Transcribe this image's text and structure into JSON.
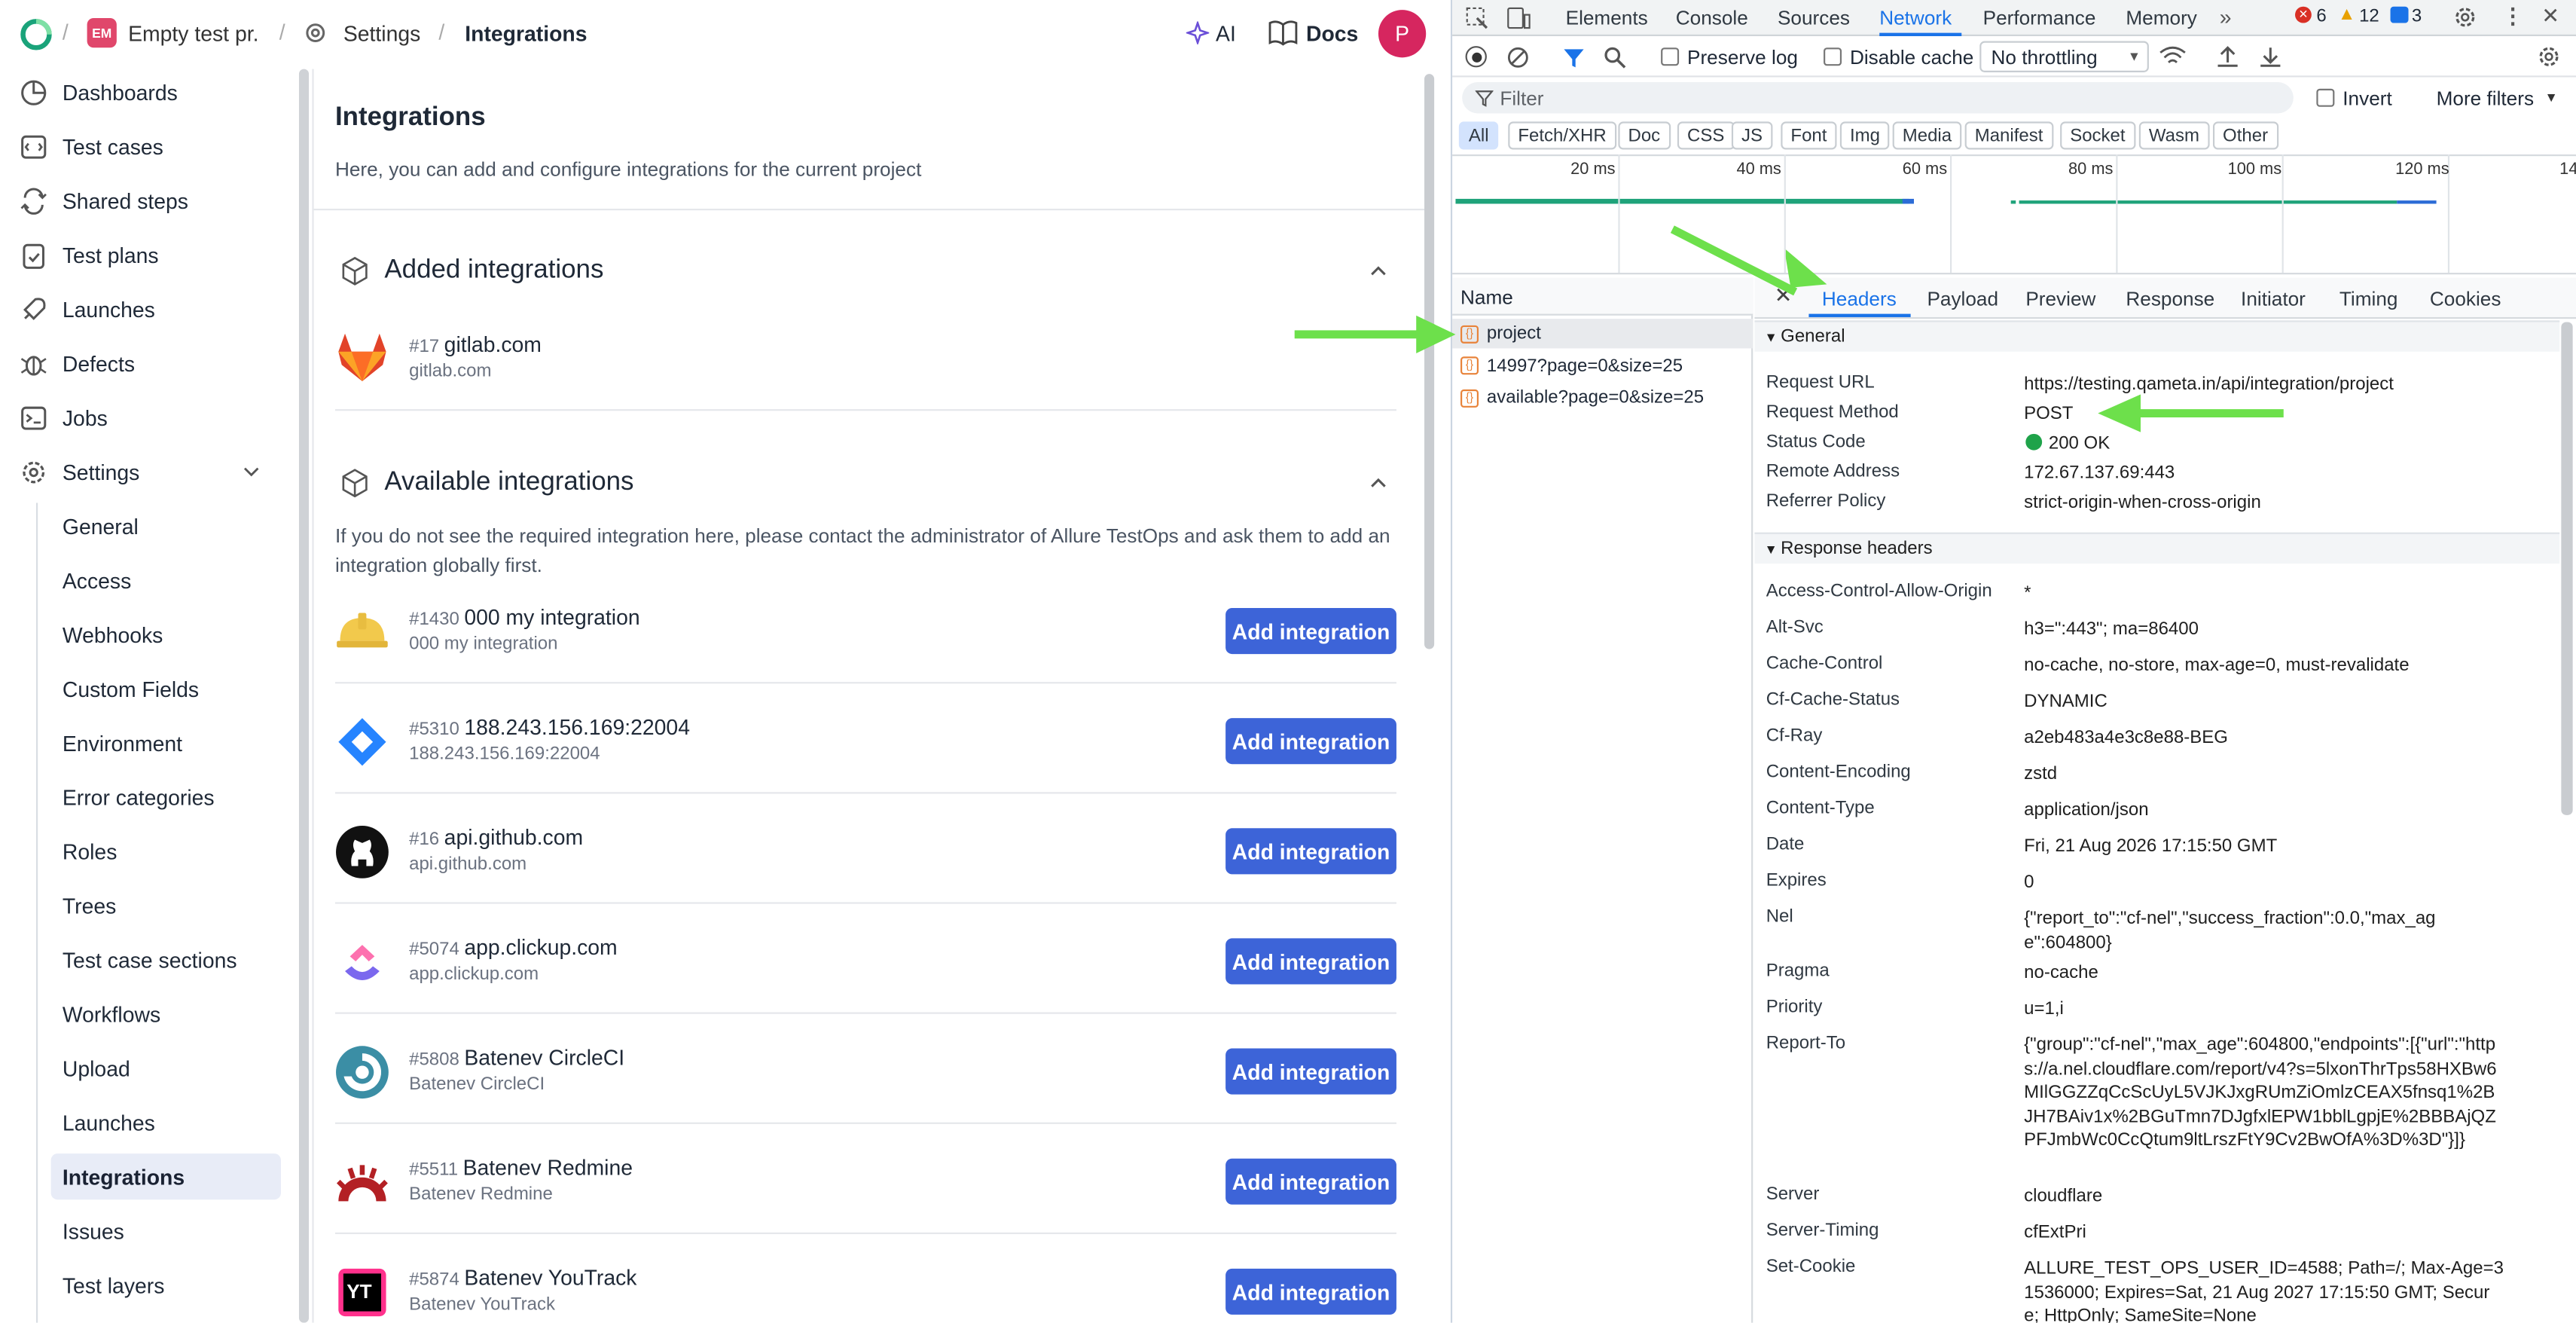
{
  "topbar": {
    "project_badge": "EM",
    "project_name": "Empty test pr.",
    "settings_label": "Settings",
    "current": "Integrations",
    "ai_label": "AI",
    "docs_label": "Docs",
    "avatar_letter": "P"
  },
  "sidebar": {
    "items": [
      {
        "label": "Dashboards",
        "icon": "dashboard-icon"
      },
      {
        "label": "Test cases",
        "icon": "test-cases-icon"
      },
      {
        "label": "Shared steps",
        "icon": "shared-steps-icon"
      },
      {
        "label": "Test plans",
        "icon": "test-plans-icon"
      },
      {
        "label": "Launches",
        "icon": "rocket-icon"
      },
      {
        "label": "Defects",
        "icon": "bug-icon"
      },
      {
        "label": "Jobs",
        "icon": "terminal-icon"
      },
      {
        "label": "Settings",
        "icon": "gear-icon"
      }
    ],
    "settings_sub": [
      "General",
      "Access",
      "Webhooks",
      "Custom Fields",
      "Environment",
      "Error categories",
      "Roles",
      "Trees",
      "Test case sections",
      "Workflows",
      "Upload",
      "Launches",
      "Integrations",
      "Issues",
      "Test layers"
    ]
  },
  "main": {
    "title": "Integrations",
    "subtitle": "Here, you can add and configure integrations for the current project",
    "added_title": "Added integrations",
    "added": {
      "id": "#17",
      "name": "gitlab.com",
      "sub": "gitlab.com"
    },
    "available_title": "Available integrations",
    "available_note": "If you do not see the required integration here, please contact the administrator of Allure TestOps and ask them to add an integration globally first.",
    "add_button": "Add integration",
    "available": [
      {
        "id": "#1430",
        "name": "000 my integration",
        "sub": "000 my integration",
        "icon": "hardhat-icon"
      },
      {
        "id": "#5310",
        "name": "188.243.156.169:22004",
        "sub": "188.243.156.169:22004",
        "icon": "jira-icon"
      },
      {
        "id": "#16",
        "name": "api.github.com",
        "sub": "api.github.com",
        "icon": "github-icon"
      },
      {
        "id": "#5074",
        "name": "app.clickup.com",
        "sub": "app.clickup.com",
        "icon": "clickup-icon"
      },
      {
        "id": "#5808",
        "name": "Batenev CircleCI",
        "sub": "Batenev CircleCI",
        "icon": "circleci-icon"
      },
      {
        "id": "#5511",
        "name": "Batenev Redmine",
        "sub": "Batenev Redmine",
        "icon": "redmine-icon"
      },
      {
        "id": "#5874",
        "name": "Batenev YouTrack",
        "sub": "Batenev YouTrack",
        "icon": "youtrack-icon"
      }
    ]
  },
  "devtools": {
    "tabs": [
      "Elements",
      "Console",
      "Sources",
      "Network",
      "Performance",
      "Memory"
    ],
    "active_tab": "Network",
    "errors": "6",
    "warnings": "12",
    "messages": "3",
    "preserve_log": "Preserve log",
    "disable_cache": "Disable cache",
    "throttling": "No throttling",
    "filter_placeholder": "Filter",
    "invert": "Invert",
    "more_filters": "More filters",
    "type_filters": [
      "All",
      "Fetch/XHR",
      "Doc",
      "CSS",
      "JS",
      "Font",
      "Img",
      "Media",
      "Manifest",
      "Socket",
      "Wasm",
      "Other"
    ],
    "timeline_ticks": [
      "20 ms",
      "40 ms",
      "60 ms",
      "80 ms",
      "100 ms",
      "120 ms",
      "14"
    ],
    "name_header": "Name",
    "requests": [
      "project",
      "14997?page=0&size=25",
      "available?page=0&size=25"
    ],
    "detail_tabs": [
      "Headers",
      "Payload",
      "Preview",
      "Response",
      "Initiator",
      "Timing",
      "Cookies"
    ],
    "general_title": "General",
    "general": [
      {
        "k": "Request URL",
        "v": "https://testing.qameta.in/api/integration/project"
      },
      {
        "k": "Request Method",
        "v": "POST"
      },
      {
        "k": "Status Code",
        "v": "200 OK"
      },
      {
        "k": "Remote Address",
        "v": "172.67.137.69:443"
      },
      {
        "k": "Referrer Policy",
        "v": "strict-origin-when-cross-origin"
      }
    ],
    "response_title": "Response headers",
    "response": [
      {
        "k": "Access-Control-Allow-Origin",
        "v": "*"
      },
      {
        "k": "Alt-Svc",
        "v": "h3=\":443\"; ma=86400"
      },
      {
        "k": "Cache-Control",
        "v": "no-cache, no-store, max-age=0, must-revalidate"
      },
      {
        "k": "Cf-Cache-Status",
        "v": "DYNAMIC"
      },
      {
        "k": "Cf-Ray",
        "v": "a2eb483a4e3c8e88-BEG"
      },
      {
        "k": "Content-Encoding",
        "v": "zstd"
      },
      {
        "k": "Content-Type",
        "v": "application/json"
      },
      {
        "k": "Date",
        "v": "Fri, 21 Aug 2026 17:15:50 GMT"
      },
      {
        "k": "Expires",
        "v": "0"
      },
      {
        "k": "Nel",
        "v": "{\"report_to\":\"cf-nel\",\"success_fraction\":0.0,\"max_age\":604800}"
      },
      {
        "k": "Pragma",
        "v": "no-cache"
      },
      {
        "k": "Priority",
        "v": "u=1,i"
      },
      {
        "k": "Report-To",
        "v": "{\"group\":\"cf-nel\",\"max_age\":604800,\"endpoints\":[{\"url\":\"https://a.nel.cloudflare.com/report/v4?s=5lxonThrTps58HXBw6MIlGGZZqCcScUyL5VJKJxgRUmZiOmlzCEAX5fnsq1%2BJH7BAiv1x%2BGuTmn7DJgfxlEPW1bblLgpjE%2BBBAjQZPFJmbWc0CcQtum9ltLrszFtY9Cv2BwOfA%3D%3D\"}]}"
      },
      {
        "k": "Server",
        "v": "cloudflare"
      },
      {
        "k": "Server-Timing",
        "v": "cfExtPri"
      },
      {
        "k": "Set-Cookie",
        "v": "ALLURE_TEST_OPS_USER_ID=4588; Path=/; Max-Age=31536000; Expires=Sat, 21 Aug 2027 17:15:50 GMT; Secure; HttpOnly; SameSite=None"
      }
    ]
  },
  "colors": {
    "accent": "#3d64d8",
    "arrow": "#6de04b",
    "devtools_blue": "#1a73e8"
  }
}
